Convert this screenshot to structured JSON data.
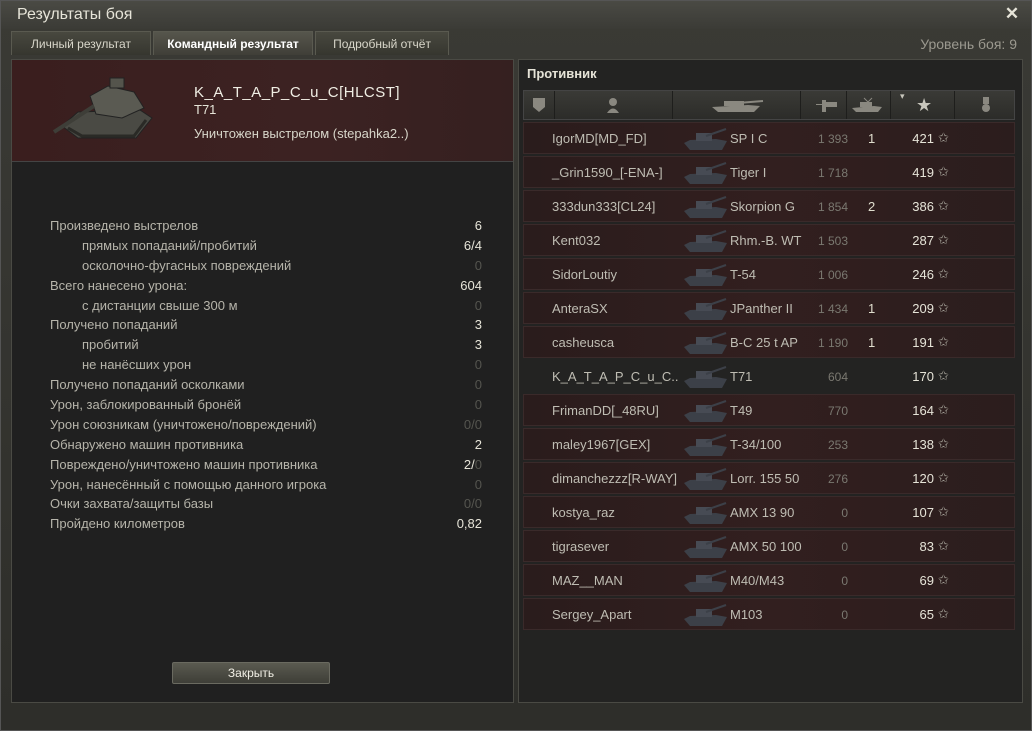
{
  "window": {
    "title": "Результаты боя"
  },
  "tabs": [
    "Личный результат",
    "Командный результат",
    "Подробный отчёт"
  ],
  "battle_level": "Уровень боя: 9",
  "player": {
    "name": "K_A_T_A_P_C_u_C[HLCST]",
    "tank": "T71",
    "destroyed_by": "Уничтожен выстрелом (stepahka2..)"
  },
  "stats": [
    {
      "label": "Произведено выстрелов",
      "value": "6",
      "indent": false
    },
    {
      "label": "прямых попаданий/пробитий",
      "value": "6/4",
      "indent": true
    },
    {
      "label": "осколочно-фугасных повреждений",
      "value": "0",
      "indent": true,
      "dim": true
    },
    {
      "label": "Всего нанесено урона:",
      "value": "604",
      "indent": false
    },
    {
      "label": "с дистанции свыше 300 м",
      "value": "0",
      "indent": true,
      "dim": true
    },
    {
      "label": "Получено попаданий",
      "value": "3",
      "indent": false
    },
    {
      "label": "пробитий",
      "value": "3",
      "indent": true
    },
    {
      "label": "не нанёсших урон",
      "value": "0",
      "indent": true,
      "dim": true
    },
    {
      "label": "Получено попаданий осколками",
      "value": "0",
      "indent": false,
      "dim": true
    },
    {
      "label": "Урон, заблокированный бронёй",
      "value": "0",
      "indent": false,
      "dim": true
    },
    {
      "label": "Урон союзникам (уничтожено/повреждений)",
      "value": "0/0",
      "indent": false,
      "dim": true
    },
    {
      "label": "Обнаружено машин противника",
      "value": "2",
      "indent": false
    },
    {
      "label": "Повреждено/уничтожено машин противника",
      "value": "2/",
      "value_dim": "0",
      "indent": false
    },
    {
      "label": "Урон, нанесённый с помощью данного игрока",
      "value": "0",
      "indent": false,
      "dim": true
    },
    {
      "label": "Очки захвата/защиты базы",
      "value": "0/0",
      "indent": false,
      "dim": true
    },
    {
      "label": "Пройдено километров",
      "value": "0,82",
      "indent": false
    }
  ],
  "close_button": "Закрыть",
  "enemy_title": "Противник",
  "players": [
    {
      "name": "IgorMD[MD_FD]",
      "tank": "SP I C",
      "damage": "1 393",
      "kills": "1",
      "xp": "421"
    },
    {
      "name": "_Grin1590_[-ENA-]",
      "tank": "Tiger I",
      "damage": "1 718",
      "kills": "",
      "xp": "419"
    },
    {
      "name": "333dun333[CL24]",
      "tank": "Skorpion G",
      "damage": "1 854",
      "kills": "2",
      "xp": "386"
    },
    {
      "name": "Kent032",
      "tank": "Rhm.-B. WT",
      "damage": "1 503",
      "kills": "",
      "xp": "287"
    },
    {
      "name": "SidorLoutiy",
      "tank": "T-54",
      "damage": "1 006",
      "kills": "",
      "xp": "246"
    },
    {
      "name": "AnteraSX",
      "tank": "JPanther II",
      "damage": "1 434",
      "kills": "1",
      "xp": "209"
    },
    {
      "name": "casheusca",
      "tank": "B-C 25 t AP",
      "damage": "1 190",
      "kills": "1",
      "xp": "191"
    },
    {
      "name": "K_A_T_A_P_C_u_C..",
      "tank": "T71",
      "damage": "604",
      "kills": "",
      "xp": "170",
      "self": true
    },
    {
      "name": "FrimanDD[_48RU]",
      "tank": "T49",
      "damage": "770",
      "kills": "",
      "xp": "164"
    },
    {
      "name": "maley1967[GEX]",
      "tank": "T-34/100",
      "damage": "253",
      "kills": "",
      "xp": "138"
    },
    {
      "name": "dimanchezzz[R-WAY]",
      "tank": "Lorr. 155 50",
      "damage": "276",
      "kills": "",
      "xp": "120"
    },
    {
      "name": "kostya_raz",
      "tank": "AMX 13 90",
      "damage": "0",
      "kills": "",
      "xp": "107"
    },
    {
      "name": "tigrasever",
      "tank": "AMX 50 100",
      "damage": "0",
      "kills": "",
      "xp": "83"
    },
    {
      "name": "MAZ__MAN",
      "tank": "M40/M43",
      "damage": "0",
      "kills": "",
      "xp": "69"
    },
    {
      "name": "Sergey_Apart",
      "tank": "M103",
      "damage": "0",
      "kills": "",
      "xp": "65"
    }
  ]
}
